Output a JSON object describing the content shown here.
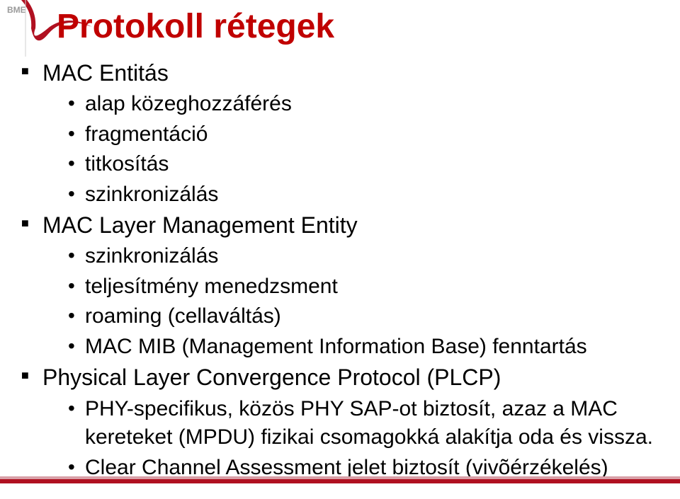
{
  "title": "Protokoll rétegek",
  "logo": {
    "text": "BME"
  },
  "sections": [
    {
      "heading": "MAC Entitás",
      "items": [
        "alap közeghozzáférés",
        "fragmentáció",
        "titkosítás",
        "szinkronizálás"
      ]
    },
    {
      "heading": "MAC Layer Management Entity",
      "items": [
        "szinkronizálás",
        "teljesítmény menedzsment",
        "roaming (cellaváltás)",
        "MAC MIB (Management Information Base) fenntartás"
      ]
    },
    {
      "heading": "Physical Layer Convergence Protocol (PLCP)",
      "items": [
        "PHY-specifikus, közös PHY SAP-ot biztosít, azaz a MAC kereteket (MPDU) fizikai csomagokká alakítja oda és vissza.",
        "Clear Channel Assessment jelet biztosít (vivõérzékelés)"
      ]
    }
  ]
}
